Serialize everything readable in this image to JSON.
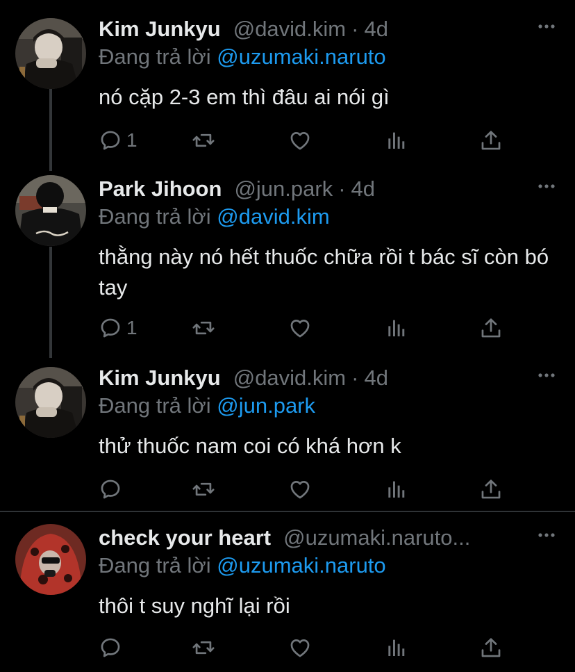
{
  "theme": {
    "background": "#000000",
    "text": "#e7e9ea",
    "muted": "#71767b",
    "link": "#1d9bf0"
  },
  "replying_prefix": "Đang trả lời",
  "tweets": [
    {
      "name": "Kim Junkyu",
      "handle": "@david.kim",
      "dot": "·",
      "time": "4d",
      "replying_to": "@uzumaki.naruto",
      "text": "nó cặp 2-3 em thì đâu ai nói gì",
      "reply_count": "1",
      "avatar_icon": "profile-photo"
    },
    {
      "name": "Park Jihoon",
      "handle": "@jun.park",
      "dot": "·",
      "time": "4d",
      "replying_to": "@david.kim",
      "text": "thằng này nó hết thuốc chữa rồi t bác sĩ còn bó tay",
      "reply_count": "1",
      "avatar_icon": "profile-photo"
    },
    {
      "name": "Kim Junkyu",
      "handle": "@david.kim",
      "dot": "·",
      "time": "4d",
      "replying_to": "@jun.park",
      "text": "thử thuốc nam coi có khá hơn k",
      "reply_count": "",
      "avatar_icon": "profile-photo"
    },
    {
      "name": "check your heart",
      "handle": "@uzumaki.naruto...",
      "dot": "",
      "time": "",
      "replying_to": "@uzumaki.naruto",
      "text": "thôi t suy nghĩ lại rồi",
      "reply_count": "",
      "avatar_icon": "profile-photo"
    }
  ],
  "action_icons": [
    "reply-icon",
    "retweet-icon",
    "like-icon",
    "analytics-icon",
    "share-icon"
  ]
}
